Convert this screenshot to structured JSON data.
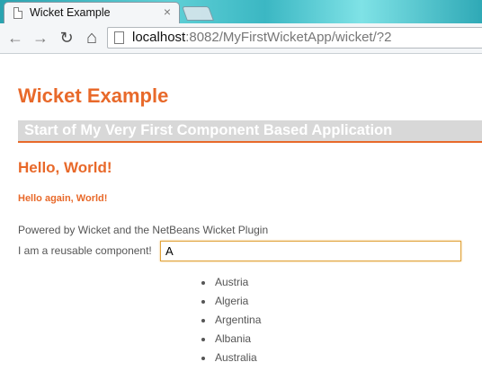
{
  "browser": {
    "tab_title": "Wicket Example",
    "tab_close": "×",
    "nav": {
      "back": "←",
      "forward": "→",
      "reload": "↻",
      "home": "⌂"
    },
    "url_host": "localhost",
    "url_rest": ":8082/MyFirstWicketApp/wicket/?2"
  },
  "page": {
    "title": "Wicket Example",
    "banner": "Start of My Very First Component Based Application",
    "hello": "Hello, World!",
    "hello_again": "Hello again, World!",
    "powered_by": "Powered by Wicket and the NetBeans Wicket Plugin",
    "reusable_label": "I am a reusable component!",
    "reusable_value": "A"
  },
  "suggestions": [
    "Austria",
    "Algeria",
    "Argentina",
    "Albania",
    "Australia"
  ],
  "colors": {
    "heading": "#e8692a",
    "banner_bg": "#d8d8d8",
    "input_border": "#e0a33a"
  }
}
